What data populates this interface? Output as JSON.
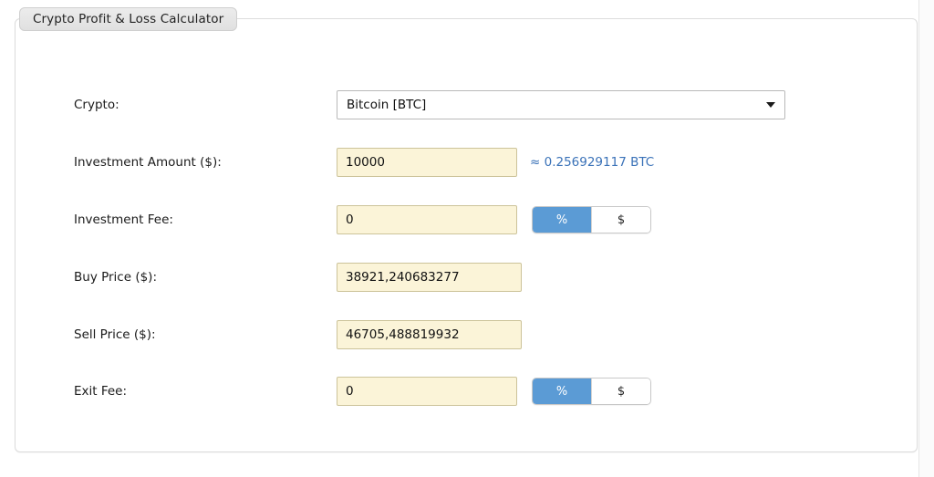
{
  "panel": {
    "legend": "Crypto Profit & Loss Calculator"
  },
  "form": {
    "crypto": {
      "label": "Crypto:",
      "selected": "Bitcoin [BTC]"
    },
    "investment_amount": {
      "label": "Investment Amount ($):",
      "value": "10000",
      "hint": "≈ 0.256929117 BTC"
    },
    "investment_fee": {
      "label": "Investment Fee:",
      "value": "0",
      "unit_percent": "%",
      "unit_dollar": "$",
      "selected_unit": "%"
    },
    "buy_price": {
      "label": "Buy Price ($):",
      "value": "38921,240683277"
    },
    "sell_price": {
      "label": "Sell Price ($):",
      "value": "46705,488819932"
    },
    "exit_fee": {
      "label": "Exit Fee:",
      "value": "0",
      "unit_percent": "%",
      "unit_dollar": "$",
      "selected_unit": "%"
    }
  },
  "colors": {
    "accent_blue": "#5b9bd5",
    "hint_blue": "#3a72b8",
    "input_bg": "#fbf4d8",
    "input_border": "#ccc39a",
    "panel_border": "#dcdcdc"
  }
}
